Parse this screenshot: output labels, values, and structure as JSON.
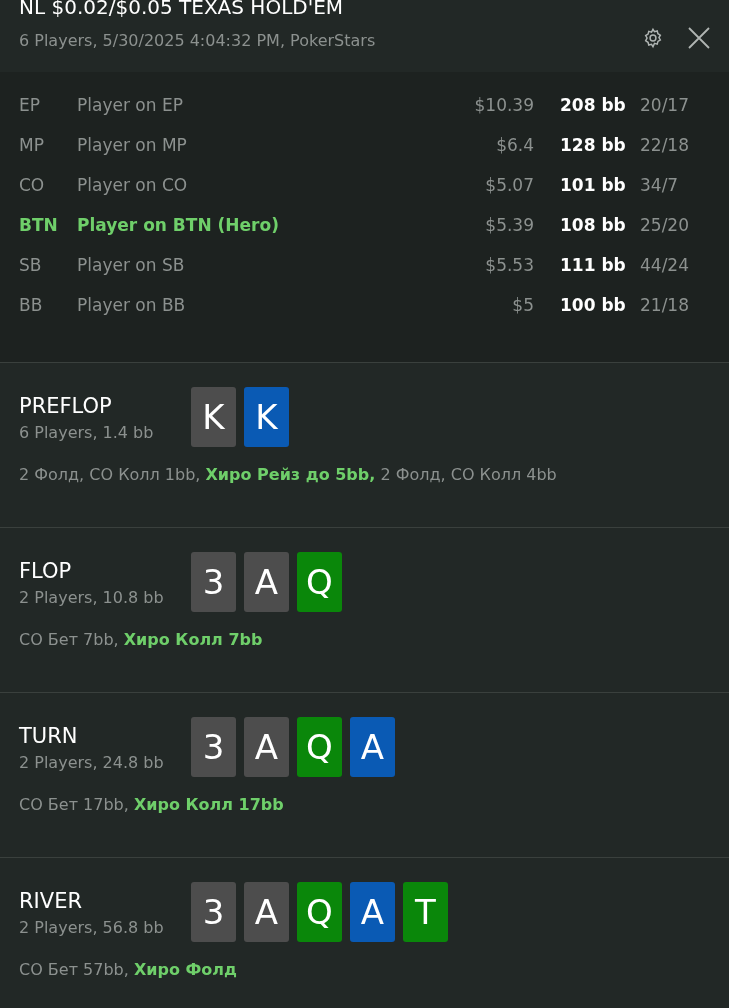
{
  "header": {
    "title": "NL $0.02/$0.05 TEXAS HOLD'EM",
    "subtitle": "6 Players, 5/30/2025 4:04:32 PM, PokerStars"
  },
  "players": [
    {
      "position": "EP",
      "name": "Player on EP",
      "stack": "$10.39",
      "bb": "208 bb",
      "stats": "20/17",
      "hero": false
    },
    {
      "position": "MP",
      "name": "Player on MP",
      "stack": "$6.4",
      "bb": "128 bb",
      "stats": "22/18",
      "hero": false
    },
    {
      "position": "CO",
      "name": "Player on CO",
      "stack": "$5.07",
      "bb": "101 bb",
      "stats": "34/7",
      "hero": false
    },
    {
      "position": "BTN",
      "name": "Player on BTN (Hero)",
      "stack": "$5.39",
      "bb": "108 bb",
      "stats": "25/20",
      "hero": true
    },
    {
      "position": "SB",
      "name": "Player on SB",
      "stack": "$5.53",
      "bb": "111 bb",
      "stats": "44/24",
      "hero": false
    },
    {
      "position": "BB",
      "name": "Player on BB",
      "stack": "$5",
      "bb": "100 bb",
      "stats": "21/18",
      "hero": false
    }
  ],
  "streets": [
    {
      "name": "PREFLOP",
      "info": "6 Players, 1.4 bb",
      "cards": [
        {
          "rank": "K",
          "color": "#4d4d4d"
        },
        {
          "rank": "K",
          "color": "#0a5ab4"
        }
      ],
      "actions": "2 Фолд, CO Колл 1bb, **Хиро Рейз до 5bb,** 2 Фолд, CO Колл 4bb"
    },
    {
      "name": "FLOP",
      "info": "2 Players, 10.8 bb",
      "cards": [
        {
          "rank": "3",
          "color": "#4d4d4d"
        },
        {
          "rank": "A",
          "color": "#4d4d4d"
        },
        {
          "rank": "Q",
          "color": "#0a870a"
        }
      ],
      "actions": "CO Бет 7bb, **Хиро Колл 7bb**"
    },
    {
      "name": "TURN",
      "info": "2 Players, 24.8 bb",
      "cards": [
        {
          "rank": "3",
          "color": "#4d4d4d"
        },
        {
          "rank": "A",
          "color": "#4d4d4d"
        },
        {
          "rank": "Q",
          "color": "#0a870a"
        },
        {
          "rank": "A",
          "color": "#0a5ab4"
        }
      ],
      "actions": "CO Бет 17bb, **Хиро Колл 17bb**"
    },
    {
      "name": "RIVER",
      "info": "2 Players, 56.8 bb",
      "cards": [
        {
          "rank": "3",
          "color": "#4d4d4d"
        },
        {
          "rank": "A",
          "color": "#4d4d4d"
        },
        {
          "rank": "Q",
          "color": "#0a870a"
        },
        {
          "rank": "A",
          "color": "#0a5ab4"
        },
        {
          "rank": "T",
          "color": "#0a870a"
        }
      ],
      "actions": "CO Бет 57bb, **Хиро Фолд**"
    }
  ]
}
